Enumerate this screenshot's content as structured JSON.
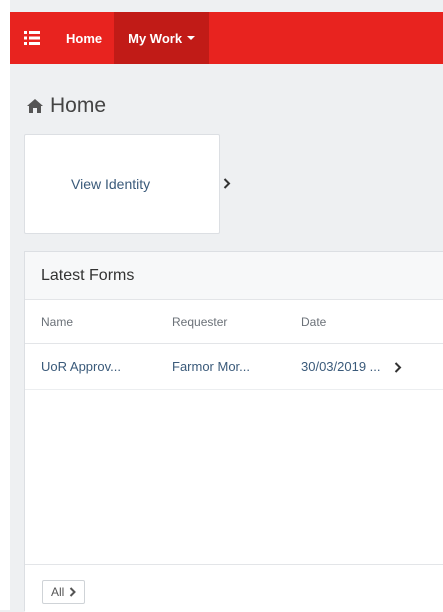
{
  "topbar": {
    "menu_icon": "list-icon",
    "nav": [
      {
        "label": "Home"
      },
      {
        "label": "My Work",
        "active": true
      }
    ],
    "brand_color": "#e8231f"
  },
  "page": {
    "title_icon": "home-icon",
    "title": "Home"
  },
  "tile": {
    "label": "View Identity",
    "icon": "chevron-right-icon"
  },
  "latest_forms": {
    "title": "Latest Forms",
    "columns": [
      "Name",
      "Requester",
      "Date"
    ],
    "rows": [
      {
        "name": "UoR Approv...",
        "requester": "Farmor Mor...",
        "date": "30/03/2019 ..."
      }
    ],
    "footer_button": "All"
  }
}
